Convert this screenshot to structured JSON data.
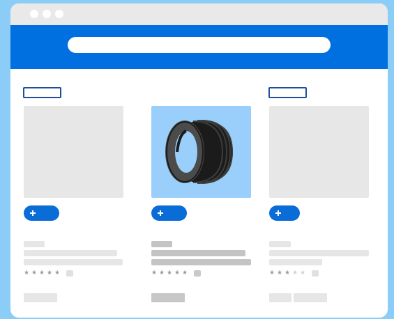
{
  "browser": {
    "controls": [
      "window-dot",
      "window-dot",
      "window-dot"
    ],
    "search": {
      "value": "",
      "placeholder": ""
    }
  },
  "products": [
    {
      "image": "placeholder",
      "rating": 5,
      "rating_max": 5,
      "highlighted": false
    },
    {
      "image": "tire-icon",
      "rating": 5,
      "rating_max": 5,
      "highlighted": true
    },
    {
      "image": "placeholder",
      "rating": 3,
      "rating_max": 5,
      "highlighted": false
    }
  ],
  "icons": {
    "add": "plus-icon",
    "product": "tire-icon"
  },
  "colors": {
    "page_bg": "#8ccdf8",
    "header": "#0070e0",
    "button": "#0a6cd6",
    "tag_border": "#1f4e9c",
    "highlight": "#99cffa"
  }
}
